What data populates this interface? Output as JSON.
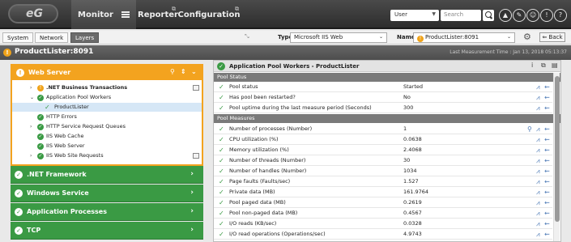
{
  "nav": {
    "monitor": "Monitor",
    "reporter": "Reporter",
    "configuration": "Configuration",
    "user_select": "User",
    "search_placeholder": "Search"
  },
  "subbar": {
    "tabs": [
      "System",
      "Network",
      "Layers"
    ],
    "type_label": "Type",
    "type_value": "Microsoft IIS Web",
    "name_label": "Name",
    "name_value": "ProductLister:8091",
    "back": "Back"
  },
  "title": {
    "name": "ProductLister:8091",
    "last_measure": "Last Measurement Time : Jan 13, 2018 05:13:37"
  },
  "left": {
    "header": "Web Server",
    "tree": [
      {
        "label": ".NET Business Transactions",
        "bold": true
      },
      {
        "label": "Application Pool Workers"
      },
      {
        "label": "ProductLister"
      },
      {
        "label": "HTTP Errors"
      },
      {
        "label": "HTTP Service Request Queues"
      },
      {
        "label": "IIS Web Cache"
      },
      {
        "label": "IIS Web Server"
      },
      {
        "label": "IIS Web Site Requests"
      }
    ],
    "groups": [
      ".NET Framework",
      "Windows Service",
      "Application Processes",
      "TCP"
    ]
  },
  "right": {
    "header": "Application Pool Workers - ProductLister",
    "sections": [
      "Pool Status",
      "Pool Measures"
    ],
    "status_rows": [
      {
        "name": "Pool status",
        "value": "Started"
      },
      {
        "name": "Has pool been restarted?",
        "value": "No"
      },
      {
        "name": "Pool uptime during the last measure period (Seconds)",
        "value": "300"
      }
    ],
    "measure_rows": [
      {
        "name": "Number of processes (Number)",
        "value": "1"
      },
      {
        "name": "CPU utilization (%)",
        "value": "0.0638"
      },
      {
        "name": "Memory utilization (%)",
        "value": "2.4068"
      },
      {
        "name": "Number of threads (Number)",
        "value": "30"
      },
      {
        "name": "Number of handles (Number)",
        "value": "1034"
      },
      {
        "name": "Page faults (Faults/sec)",
        "value": "1.527"
      },
      {
        "name": "Private data (MB)",
        "value": "161.9764"
      },
      {
        "name": "Pool paged data (MB)",
        "value": "0.2619"
      },
      {
        "name": "Pool non-paged data (MB)",
        "value": "0.4567"
      },
      {
        "name": "I/O reads (KB/sec)",
        "value": "0.0328"
      },
      {
        "name": "I/O read operations (Operations/sec)",
        "value": "4.9743"
      }
    ]
  }
}
